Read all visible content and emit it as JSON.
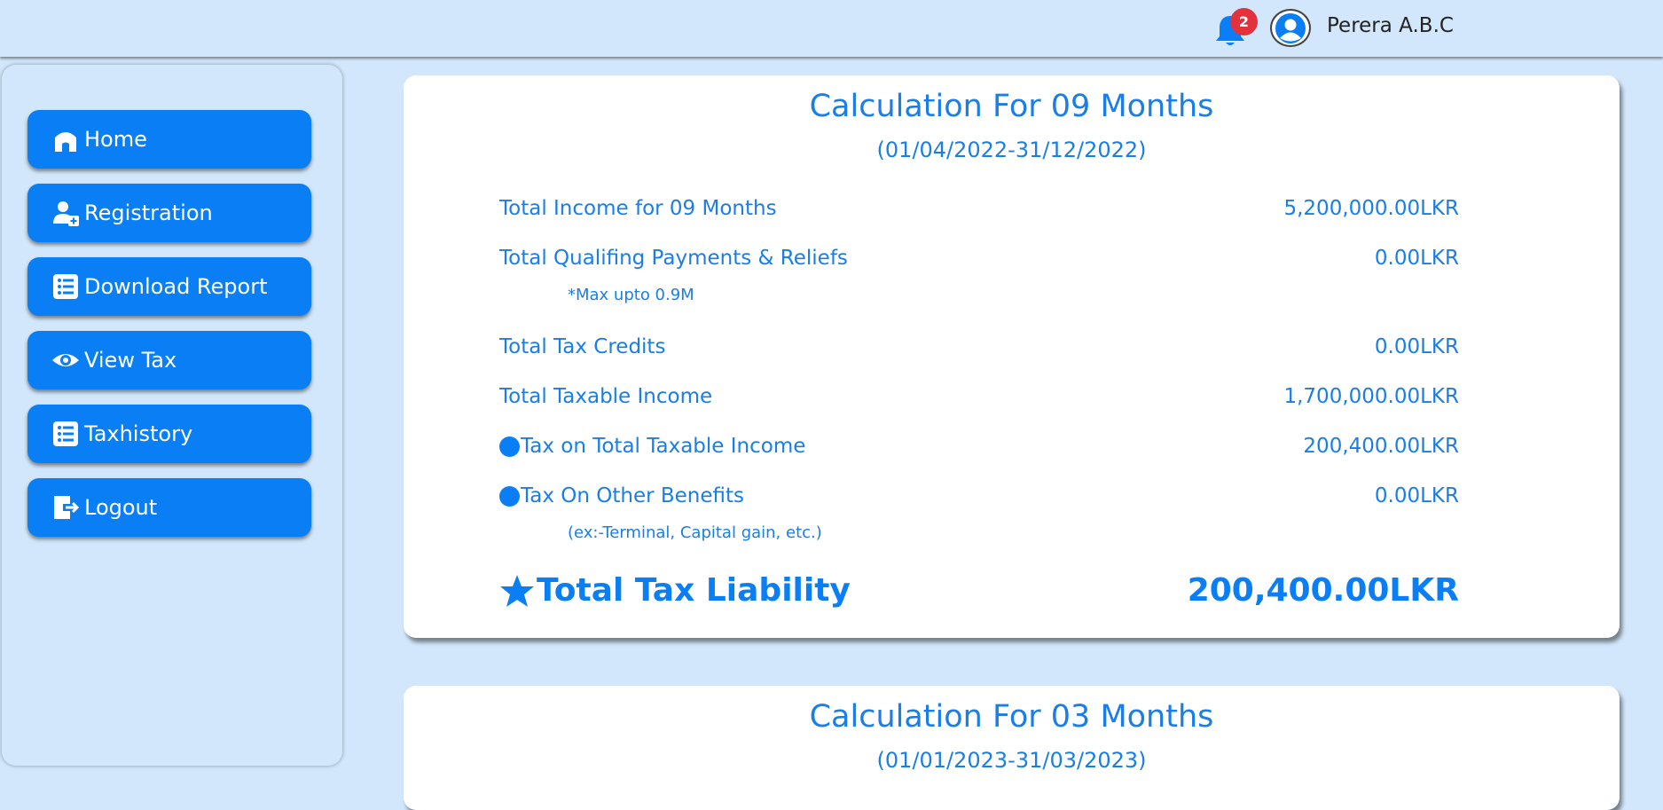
{
  "header": {
    "notification_count": "2",
    "user_name": "Perera A.B.C"
  },
  "sidebar": {
    "items": [
      {
        "label": "Home",
        "icon": "home-icon"
      },
      {
        "label": "Registration",
        "icon": "user-plus-icon"
      },
      {
        "label": "Download Report",
        "icon": "list-icon"
      },
      {
        "label": "View Tax",
        "icon": "eye-icon"
      },
      {
        "label": "Taxhistory",
        "icon": "list-icon"
      },
      {
        "label": "Logout",
        "icon": "logout-icon"
      }
    ]
  },
  "card1": {
    "title": "Calculation For 09 Months",
    "range": "(01/04/2022-31/12/2022)",
    "rows": [
      {
        "label": "Total Income for 09 Months",
        "value": "5,200,000.00LKR"
      },
      {
        "label": "Total Qualifing Payments & Reliefs",
        "value": "0.00LKR"
      },
      {
        "label": "Total Tax Credits",
        "value": "0.00LKR"
      },
      {
        "label": "Total Taxable Income",
        "value": "1,700,000.00LKR"
      },
      {
        "label": "Tax on Total Taxable Income",
        "value": "200,400.00LKR"
      },
      {
        "label": "Tax On Other Benefits",
        "value": "0.00LKR"
      }
    ],
    "notes": {
      "reliefs": "*Max upto 0.9M",
      "benefits": "(ex:-Terminal, Capital gain, etc.)"
    },
    "total": {
      "label": "Total Tax Liability",
      "value": "200,400.00LKR"
    }
  },
  "card2": {
    "title": "Calculation For 03 Months",
    "range": "(01/01/2023-31/03/2023)"
  },
  "colors": {
    "background": "#d2e7fb",
    "primary": "#0a7ff5",
    "text": "#1a7ee6",
    "badge": "#e3323c"
  }
}
